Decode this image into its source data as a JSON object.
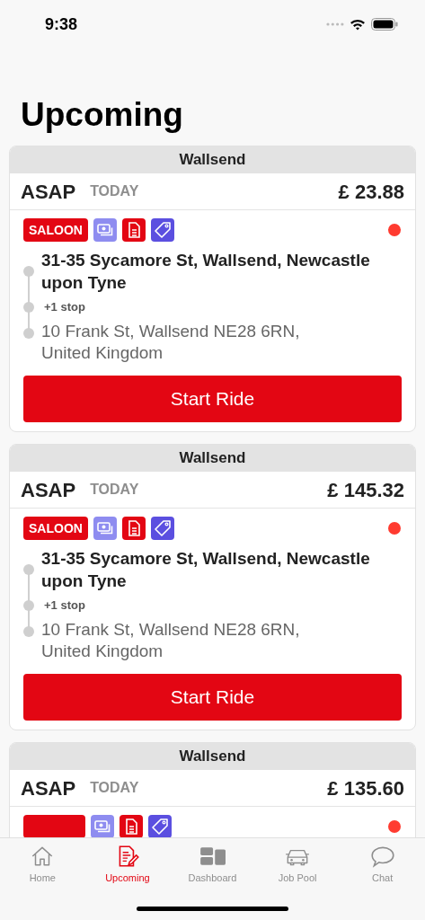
{
  "status_bar": {
    "time": "9:38"
  },
  "title": "Upcoming",
  "rides": [
    {
      "region": "Wallsend",
      "time": "ASAP",
      "day": "TODAY",
      "price": "£ 23.88",
      "color": "#ff3b30",
      "badges": [
        {
          "kind": "vehicle",
          "label": "SALOON"
        },
        {
          "kind": "cash"
        },
        {
          "kind": "document"
        },
        {
          "kind": "tag"
        }
      ],
      "pickup": "31-35 Sycamore St, Wallsend, Newcastle upon Tyne",
      "stops": "+1 stop",
      "dropoff": "10 Frank St, Wallsend NE28 6RN, United Kingdom",
      "button": "Start Ride"
    },
    {
      "region": "Wallsend",
      "time": "ASAP",
      "day": "TODAY",
      "price": "£ 145.32",
      "color": "#ff3b30",
      "badges": [
        {
          "kind": "vehicle",
          "label": "SALOON"
        },
        {
          "kind": "cash"
        },
        {
          "kind": "document"
        },
        {
          "kind": "tag"
        }
      ],
      "pickup": "31-35 Sycamore St, Wallsend, Newcastle upon Tyne",
      "stops": "+1 stop",
      "dropoff": "10 Frank St, Wallsend NE28 6RN, United Kingdom",
      "button": "Start Ride"
    },
    {
      "region": "Wallsend",
      "time": "ASAP",
      "day": "TODAY",
      "price": "£ 135.60",
      "color": "#ff3b30",
      "badges": [
        {
          "kind": "vehicle"
        },
        {
          "kind": "cash"
        },
        {
          "kind": "document"
        },
        {
          "kind": "tag"
        }
      ]
    }
  ],
  "tabs": [
    {
      "kind": "home",
      "label": "Home",
      "selected": false
    },
    {
      "kind": "upcoming",
      "label": "Upcoming",
      "selected": true
    },
    {
      "kind": "dashboard",
      "label": "Dashboard",
      "selected": false
    },
    {
      "kind": "car",
      "label": "Job Pool",
      "selected": false
    },
    {
      "kind": "chat",
      "label": "Chat",
      "selected": false
    }
  ]
}
